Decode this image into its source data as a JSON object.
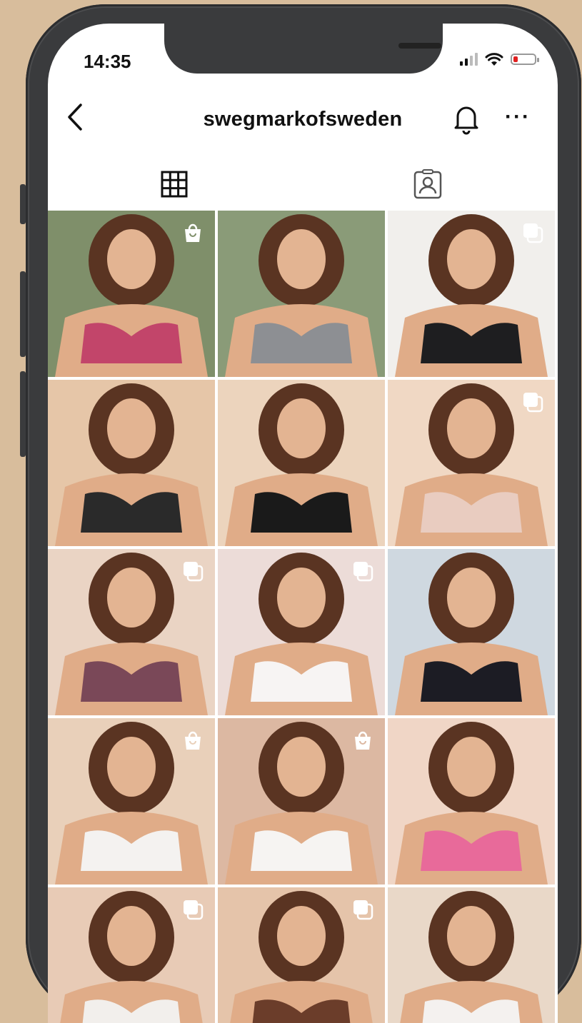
{
  "status_bar": {
    "time": "14:35",
    "battery_level": 0.2
  },
  "header": {
    "username": "swegmarkofsweden"
  },
  "icons": {
    "back": "back-chevron-icon",
    "bell": "notification-bell-icon",
    "more": "more-options-icon",
    "grid_tab": "grid-icon",
    "tagged_tab": "tagged-portrait-icon",
    "multi": "multiple-photos-icon",
    "shop": "shopping-bag-icon"
  },
  "more_glyph": "···",
  "colors": {
    "background": "#d8bd9c",
    "phone": "#3a3b3d",
    "battery_low": "#e02020"
  },
  "posts": [
    {
      "badge": "shopping-bag-icon",
      "bg": "#7f8f6a",
      "accent": "#c2456a"
    },
    {
      "badge": "",
      "bg": "#8a9b78",
      "accent": "#8d8f93"
    },
    {
      "badge": "multiple-photos-icon",
      "bg": "#f1efec",
      "accent": "#1e1e20"
    },
    {
      "badge": "",
      "bg": "#e6c6a8",
      "accent": "#2a2a2a"
    },
    {
      "badge": "",
      "bg": "#ecd4bd",
      "accent": "#1a1a1a"
    },
    {
      "badge": "multiple-photos-icon",
      "bg": "#f0d8c4",
      "accent": "#e9ccc0"
    },
    {
      "badge": "multiple-photos-icon",
      "bg": "#ead4c4",
      "accent": "#7a4858"
    },
    {
      "badge": "multiple-photos-icon",
      "bg": "#ecdcd8",
      "accent": "#f7f4f3"
    },
    {
      "badge": "",
      "bg": "#cfd8e0",
      "accent": "#1c1c24"
    },
    {
      "badge": "shopping-bag-icon",
      "bg": "#e9d0ba",
      "accent": "#f4f2f0"
    },
    {
      "badge": "shopping-bag-icon",
      "bg": "#dcb8a2",
      "accent": "#f6f4f2"
    },
    {
      "badge": "",
      "bg": "#f0d6c6",
      "accent": "#e86a9a"
    },
    {
      "badge": "multiple-photos-icon",
      "bg": "#e8cbb6",
      "accent": "#f2efec"
    },
    {
      "badge": "multiple-photos-icon",
      "bg": "#e5c4aa",
      "accent": "#6b3d2a"
    },
    {
      "badge": "",
      "bg": "#e9d8c8",
      "accent": "#f4f1ef"
    }
  ]
}
